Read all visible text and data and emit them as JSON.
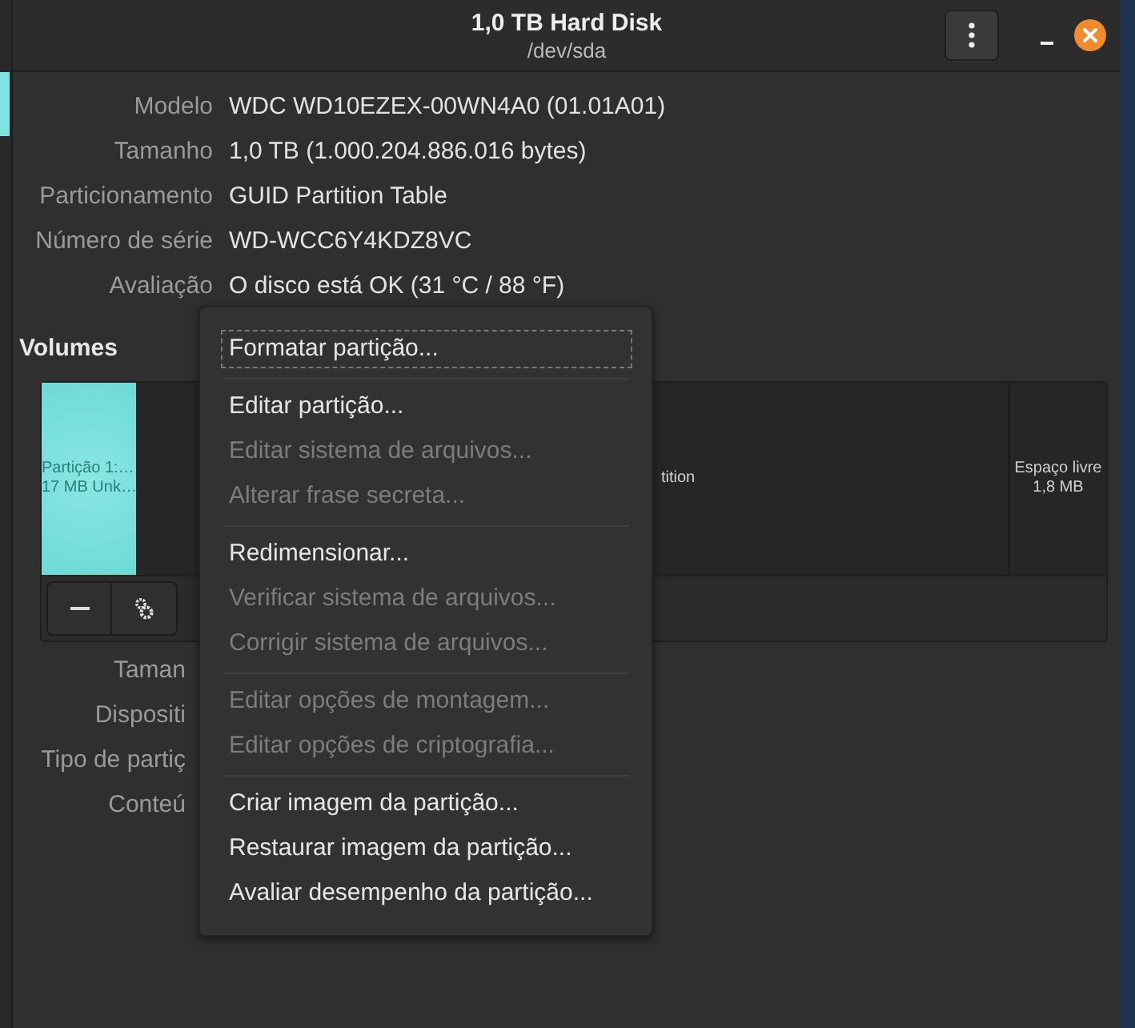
{
  "window": {
    "title": "1,0 TB Hard Disk",
    "subtitle": "/dev/sda"
  },
  "disk_details": [
    {
      "label": "Modelo",
      "value": "WDC WD10EZEX-00WN4A0 (01.01A01)"
    },
    {
      "label": "Tamanho",
      "value": "1,0 TB (1.000.204.886.016 bytes)"
    },
    {
      "label": "Particionamento",
      "value": "GUID Partition Table"
    },
    {
      "label": "Número de série",
      "value": "WD-WCC6Y4KDZ8VC"
    },
    {
      "label": "Avaliação",
      "value": "O disco está OK (31 °C / 88 °F)"
    }
  ],
  "volumes": {
    "title": "Volumes",
    "segments": [
      {
        "kind": "partition",
        "selected": true,
        "lines": [
          "Partição 1:…",
          "17 MB Unk…"
        ]
      },
      {
        "kind": "partition",
        "selected": false,
        "lines": [
          "tition"
        ]
      },
      {
        "kind": "free",
        "selected": false,
        "lines": [
          "Espaço livre",
          "1,8 MB"
        ]
      }
    ]
  },
  "volume_details_labels": [
    "Taman",
    "Dispositi",
    "Tipo de partiç",
    "Conteú"
  ],
  "context_menu": {
    "sections": [
      [
        {
          "label": "Formatar partição...",
          "disabled": false,
          "focused": true
        }
      ],
      [
        {
          "label": "Editar partição...",
          "disabled": false,
          "focused": false
        },
        {
          "label": "Editar sistema de arquivos...",
          "disabled": true,
          "focused": false
        },
        {
          "label": "Alterar frase secreta...",
          "disabled": true,
          "focused": false
        }
      ],
      [
        {
          "label": "Redimensionar...",
          "disabled": false,
          "focused": false
        },
        {
          "label": "Verificar sistema de arquivos...",
          "disabled": true,
          "focused": false
        },
        {
          "label": "Corrigir sistema de arquivos...",
          "disabled": true,
          "focused": false
        }
      ],
      [
        {
          "label": "Editar opções de montagem...",
          "disabled": true,
          "focused": false
        },
        {
          "label": "Editar opções de criptografia...",
          "disabled": true,
          "focused": false
        }
      ],
      [
        {
          "label": "Criar imagem da partição...",
          "disabled": false,
          "focused": false
        },
        {
          "label": "Restaurar imagem da partição...",
          "disabled": false,
          "focused": false
        },
        {
          "label": "Avaliar desempenho da partição...",
          "disabled": false,
          "focused": false
        }
      ]
    ]
  }
}
